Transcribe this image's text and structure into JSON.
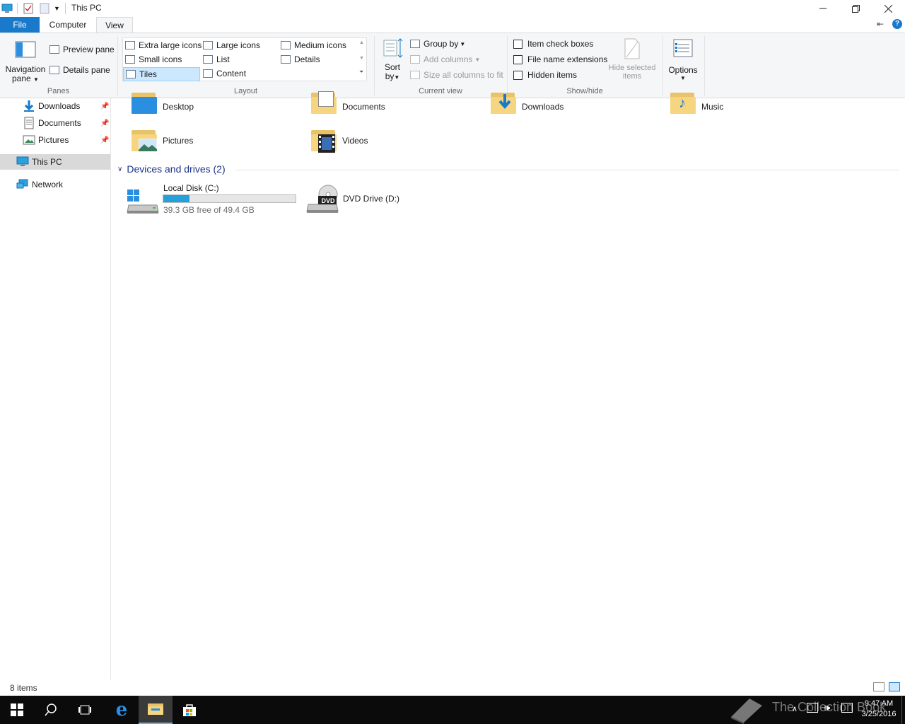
{
  "window": {
    "title": "This PC"
  },
  "tabs": {
    "file": "File",
    "computer": "Computer",
    "view": "View"
  },
  "ribbon": {
    "panes": {
      "label": "Panes",
      "navigation_pane": "Navigation pane",
      "navigation_line1": "Navigation",
      "navigation_line2": "pane",
      "preview_pane": "Preview pane",
      "details_pane": "Details pane"
    },
    "layout": {
      "label": "Layout",
      "options": [
        "Extra large icons",
        "Large icons",
        "Medium icons",
        "Small icons",
        "List",
        "Details",
        "Tiles",
        "Content"
      ],
      "selected": "Tiles"
    },
    "current_view": {
      "label": "Current view",
      "sort_by_line1": "Sort",
      "sort_by_line2": "by",
      "group_by": "Group by",
      "add_columns": "Add columns",
      "size_all_columns": "Size all columns to fit"
    },
    "show_hide": {
      "label": "Show/hide",
      "item_check_boxes": "Item check boxes",
      "file_name_extensions": "File name extensions",
      "hidden_items": "Hidden items",
      "hide_selected_line1": "Hide selected",
      "hide_selected_line2": "items"
    },
    "options": {
      "label": "Options"
    }
  },
  "nav": {
    "items": [
      {
        "label": "Downloads",
        "icon": "downloads-icon",
        "pinned": true
      },
      {
        "label": "Documents",
        "icon": "documents-icon",
        "pinned": true
      },
      {
        "label": "Pictures",
        "icon": "pictures-icon",
        "pinned": true
      },
      {
        "label": "This PC",
        "icon": "pc-icon",
        "selected": true
      },
      {
        "label": "Network",
        "icon": "network-icon"
      }
    ]
  },
  "content": {
    "folders": [
      {
        "label": "Desktop"
      },
      {
        "label": "Documents"
      },
      {
        "label": "Downloads"
      },
      {
        "label": "Music"
      },
      {
        "label": "Pictures"
      },
      {
        "label": "Videos"
      }
    ],
    "devices_header": "Devices and drives (2)",
    "drives": [
      {
        "label": "Local Disk (C:)",
        "free_text": "39.3 GB free of 49.4 GB",
        "used_fraction": 0.2
      },
      {
        "label": "DVD Drive (D:)",
        "badge": "DVD"
      }
    ]
  },
  "status": {
    "items_count": "8 items"
  },
  "taskbar": {
    "time": "9:47 AM",
    "date": "3/25/2016",
    "watermark": "The Collection Book"
  },
  "colors": {
    "accent": "#1979ca",
    "progress": "#26a0da",
    "selection": "#cce8ff"
  }
}
